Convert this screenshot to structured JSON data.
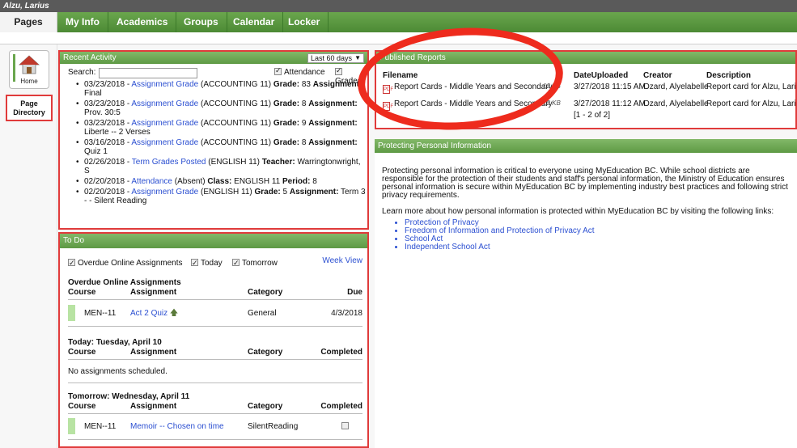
{
  "user": {
    "name": "Alzu, Larius"
  },
  "nav": {
    "pages_label": "Pages",
    "tabs": [
      {
        "label": "My Info"
      },
      {
        "label": "Academics"
      },
      {
        "label": "Groups"
      },
      {
        "label": "Calendar"
      },
      {
        "label": "Locker"
      }
    ]
  },
  "sidebar": {
    "home_label": "Home",
    "page_dir_label_1": "Page",
    "page_dir_label_2": "Directory"
  },
  "recent": {
    "title": "Recent Activity",
    "range": "Last 60 days",
    "search_label": "Search:",
    "search_value": "",
    "attendance_label": "Attendance",
    "grades_label": "Grades",
    "items": [
      {
        "date": "03/23/2018 - ",
        "type": "Assignment Grade",
        "course": " (ACCOUNTING 11) ",
        "k1": "Grade:",
        "v1": " 83 ",
        "k2": "Assignment:",
        "v2": " Final"
      },
      {
        "date": "03/23/2018 - ",
        "type": "Assignment Grade",
        "course": " (ACCOUNTING 11) ",
        "k1": "Grade:",
        "v1": " 8 ",
        "k2": "Assignment:",
        "v2": " Prov. 30:5"
      },
      {
        "date": "03/23/2018 - ",
        "type": "Assignment Grade",
        "course": " (ACCOUNTING 11) ",
        "k1": "Grade:",
        "v1": " 9 ",
        "k2": "Assignment:",
        "v2": " Liberte -- 2 Verses"
      },
      {
        "date": "03/16/2018 - ",
        "type": "Assignment Grade",
        "course": " (ACCOUNTING 11) ",
        "k1": "Grade:",
        "v1": " 8 ",
        "k2": "Assignment:",
        "v2": " Quiz 1"
      },
      {
        "date": "02/26/2018 - ",
        "type": "Term Grades Posted",
        "course": " (ENGLISH 11) ",
        "k1": "Teacher:",
        "v1": " Warringtonwright, S",
        "k2": "",
        "v2": ""
      },
      {
        "date": "02/20/2018 - ",
        "type": "Attendance",
        "course": " (Absent) ",
        "k1": "Class:",
        "v1": " ENGLISH 11 ",
        "k2": "Period:",
        "v2": " 8"
      },
      {
        "date": "02/20/2018 - ",
        "type": "Assignment Grade",
        "course": " (ENGLISH 11) ",
        "k1": "Grade:",
        "v1": " 5 ",
        "k2": "Assignment:",
        "v2": " Term 3 - - Silent Reading"
      }
    ]
  },
  "todo": {
    "title": "To Do",
    "week_view": "Week View",
    "filters": {
      "overdue": "Overdue Online Assignments",
      "today": "Today",
      "tomorrow": "Tomorrow"
    },
    "sections": {
      "overdue": {
        "title": "Overdue Online Assignments",
        "headers": {
          "course": "Course",
          "assignment": "Assignment",
          "category": "Category",
          "last": "Due"
        },
        "row": {
          "course": "MEN--11",
          "assignment": "Act 2 Quiz",
          "category": "General",
          "last": "4/3/2018"
        }
      },
      "today": {
        "title": "Today: Tuesday, April 10",
        "headers": {
          "course": "Course",
          "assignment": "Assignment",
          "category": "Category",
          "last": "Completed"
        },
        "empty": "No assignments scheduled."
      },
      "tomorrow": {
        "title": "Tomorrow: Wednesday, April 11",
        "headers": {
          "course": "Course",
          "assignment": "Assignment",
          "category": "Category",
          "last": "Completed"
        },
        "row": {
          "course": "MEN--11",
          "assignment": "Memoir -- Chosen on time",
          "category": "SilentReading"
        }
      }
    }
  },
  "reports": {
    "title": "Published Reports",
    "headers": {
      "filename": "Filename",
      "date": "DateUploaded",
      "creator": "Creator",
      "description": "Description"
    },
    "rows": [
      {
        "filename": "Report Cards - Middle Years and Secondary",
        "size": "12 KB",
        "date": "3/27/2018 11:15 AM",
        "creator": "Ozard, Alyelabelle",
        "description": "Report card for Alzu, Larius"
      },
      {
        "filename": "Report Cards - Middle Years and Secondary",
        "size": "12 KB",
        "date": "3/27/2018 11:12 AM",
        "creator": "Ozard, Alyelabelle",
        "description": "Report card for Alzu, Larius"
      }
    ],
    "pager": "[1 - 2 of 2]"
  },
  "privacy": {
    "title": "Protecting Personal Information",
    "para1": "Protecting personal information is critical to everyone using MyEducation BC. While school districts are responsible for the protection of their students and staff's personal information, the Ministry of Education ensures personal information is secure within MyEducation BC by implementing industry best practices and following strict privacy requirements.",
    "para2": "Learn more about how personal information is protected within MyEducation BC by visiting the following links:",
    "links": [
      {
        "label": "Protection of Privacy"
      },
      {
        "label": "Freedom of Information and Protection of Privacy Act"
      },
      {
        "label": "School Act"
      },
      {
        "label": "Independent School Act"
      }
    ]
  },
  "colors": {
    "accent_green": "#5e9a45",
    "annotation_red": "#ee2b1d",
    "link_blue": "#2b4fd1"
  }
}
